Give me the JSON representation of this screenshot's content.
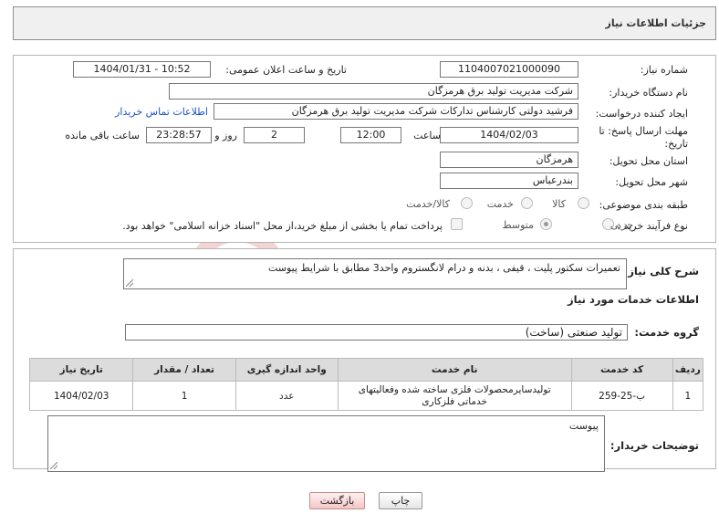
{
  "header": {
    "title": "جزئیات اطلاعات نیاز"
  },
  "form": {
    "need_number_label": "شماره نیاز:",
    "need_number": "1104007021000090",
    "announce_datetime_label": "تاریخ و ساعت اعلان عمومی:",
    "announce_datetime": "1404/01/31 - 10:52",
    "buyer_org_label": "نام دستگاه خریدار:",
    "buyer_org": "شرکت مدیریت تولید برق هرمزگان",
    "creator_label": "ایجاد کننده درخواست:",
    "creator": "فرشید دولتی کارشناس تدارکات شرکت مدیریت تولید برق هرمزگان",
    "buyer_contact_link": "اطلاعات تماس خریدار",
    "deadline_label_1": "مهلت ارسال پاسخ: تا",
    "deadline_label_2": "تاریخ:",
    "deadline_date": "1404/02/03",
    "time_label": "ساعت",
    "deadline_time": "12:00",
    "days_value": "2",
    "days_label": "روز و",
    "remaining_time": "23:28:57",
    "remaining_label": "ساعت باقی مانده",
    "province_label": "استان محل تحویل:",
    "province": "هرمزگان",
    "city_label": "شهر محل تحویل:",
    "city": "بندرعباس",
    "category_label": "طبقه بندی موضوعی:",
    "category_options": [
      "کالا",
      "خدمت",
      "کالا/خدمت"
    ],
    "category_selected": "خدمت",
    "purchase_type_label": "نوع فرآیند خرید :",
    "purchase_options": [
      "جزیی",
      "متوسط"
    ],
    "purchase_selected": "متوسط",
    "payment_note": "پرداخت تمام یا بخشی از مبلغ خرید،از محل \"اسناد خزانه اسلامی\" خواهد بود."
  },
  "summary": {
    "label": "شرح کلی نیاز:",
    "text": "تعمیرات سکتور پلیت ، قیفی ، بدنه و درام لانگستروم  واحد3 مطابق با شرایط پیوست"
  },
  "services": {
    "section_title": "اطلاعات خدمات مورد نیاز",
    "group_label": "گروه خدمت:",
    "group_value": "تولید صنعتی (ساخت)",
    "columns": [
      "ردیف",
      "کد خدمت",
      "نام خدمت",
      "واحد اندازه گیری",
      "تعداد / مقدار",
      "تاریخ نیاز"
    ],
    "rows": [
      {
        "row": "1",
        "code": "ب-25-259",
        "name": "تولیدسایرمحصولات فلزی ساخته شده وفعالیتهای خدماتی فلزکاری",
        "unit": "عدد",
        "qty": "1",
        "date": "1404/02/03"
      }
    ]
  },
  "buyer_notes": {
    "label": "توضیحات خریدار:",
    "text": "پیوست"
  },
  "buttons": {
    "print": "چاپ",
    "back": "بازگشت"
  },
  "watermark": {
    "text": "AriaTender.neT"
  }
}
